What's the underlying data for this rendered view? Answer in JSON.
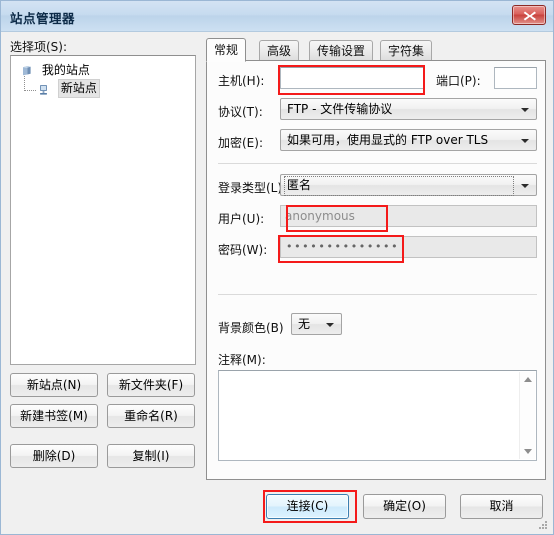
{
  "window": {
    "title": "站点管理器",
    "close_icon": "close-icon"
  },
  "left_panel": {
    "label": "选择项(S):",
    "tree": [
      {
        "label": "我的站点",
        "icon": "folder-sites-icon",
        "level": 0,
        "selected": false
      },
      {
        "label": "新站点",
        "icon": "server-icon",
        "level": 1,
        "selected": true
      }
    ],
    "buttons": [
      {
        "label": "新站点(N)"
      },
      {
        "label": "新文件夹(F)"
      },
      {
        "label": "新建书签(M)"
      },
      {
        "label": "重命名(R)"
      },
      {
        "label": "删除(D)"
      },
      {
        "label": "复制(I)"
      }
    ]
  },
  "tabs": [
    {
      "label": "常规",
      "active": true
    },
    {
      "label": "高级",
      "active": false
    },
    {
      "label": "传输设置",
      "active": false
    },
    {
      "label": "字符集",
      "active": false
    }
  ],
  "general_tab": {
    "host": {
      "label": "主机(H):",
      "value": "",
      "placeholder": ""
    },
    "port": {
      "label": "端口(P):",
      "value": "",
      "placeholder": ""
    },
    "protocol": {
      "label": "协议(T):",
      "value": "FTP - 文件传输协议"
    },
    "encryption": {
      "label": "加密(E):",
      "value": "如果可用，使用显式的 FTP over TLS"
    },
    "logon_type": {
      "label": "登录类型(L):",
      "value": "匿名"
    },
    "user": {
      "label": "用户(U):",
      "value": "anonymous",
      "disabled": true
    },
    "password": {
      "label": "密码(W):",
      "value": "••••••••••••••",
      "disabled": true
    },
    "background_color": {
      "label": "背景颜色(B)",
      "value": "无"
    },
    "comments": {
      "label": "注释(M):",
      "value": ""
    }
  },
  "footer": {
    "connect": "连接(C)",
    "ok": "确定(O)",
    "cancel": "取消"
  },
  "annotations": {
    "accent_color": "#f41a1a",
    "highlight_color": "#3c7fb1"
  }
}
